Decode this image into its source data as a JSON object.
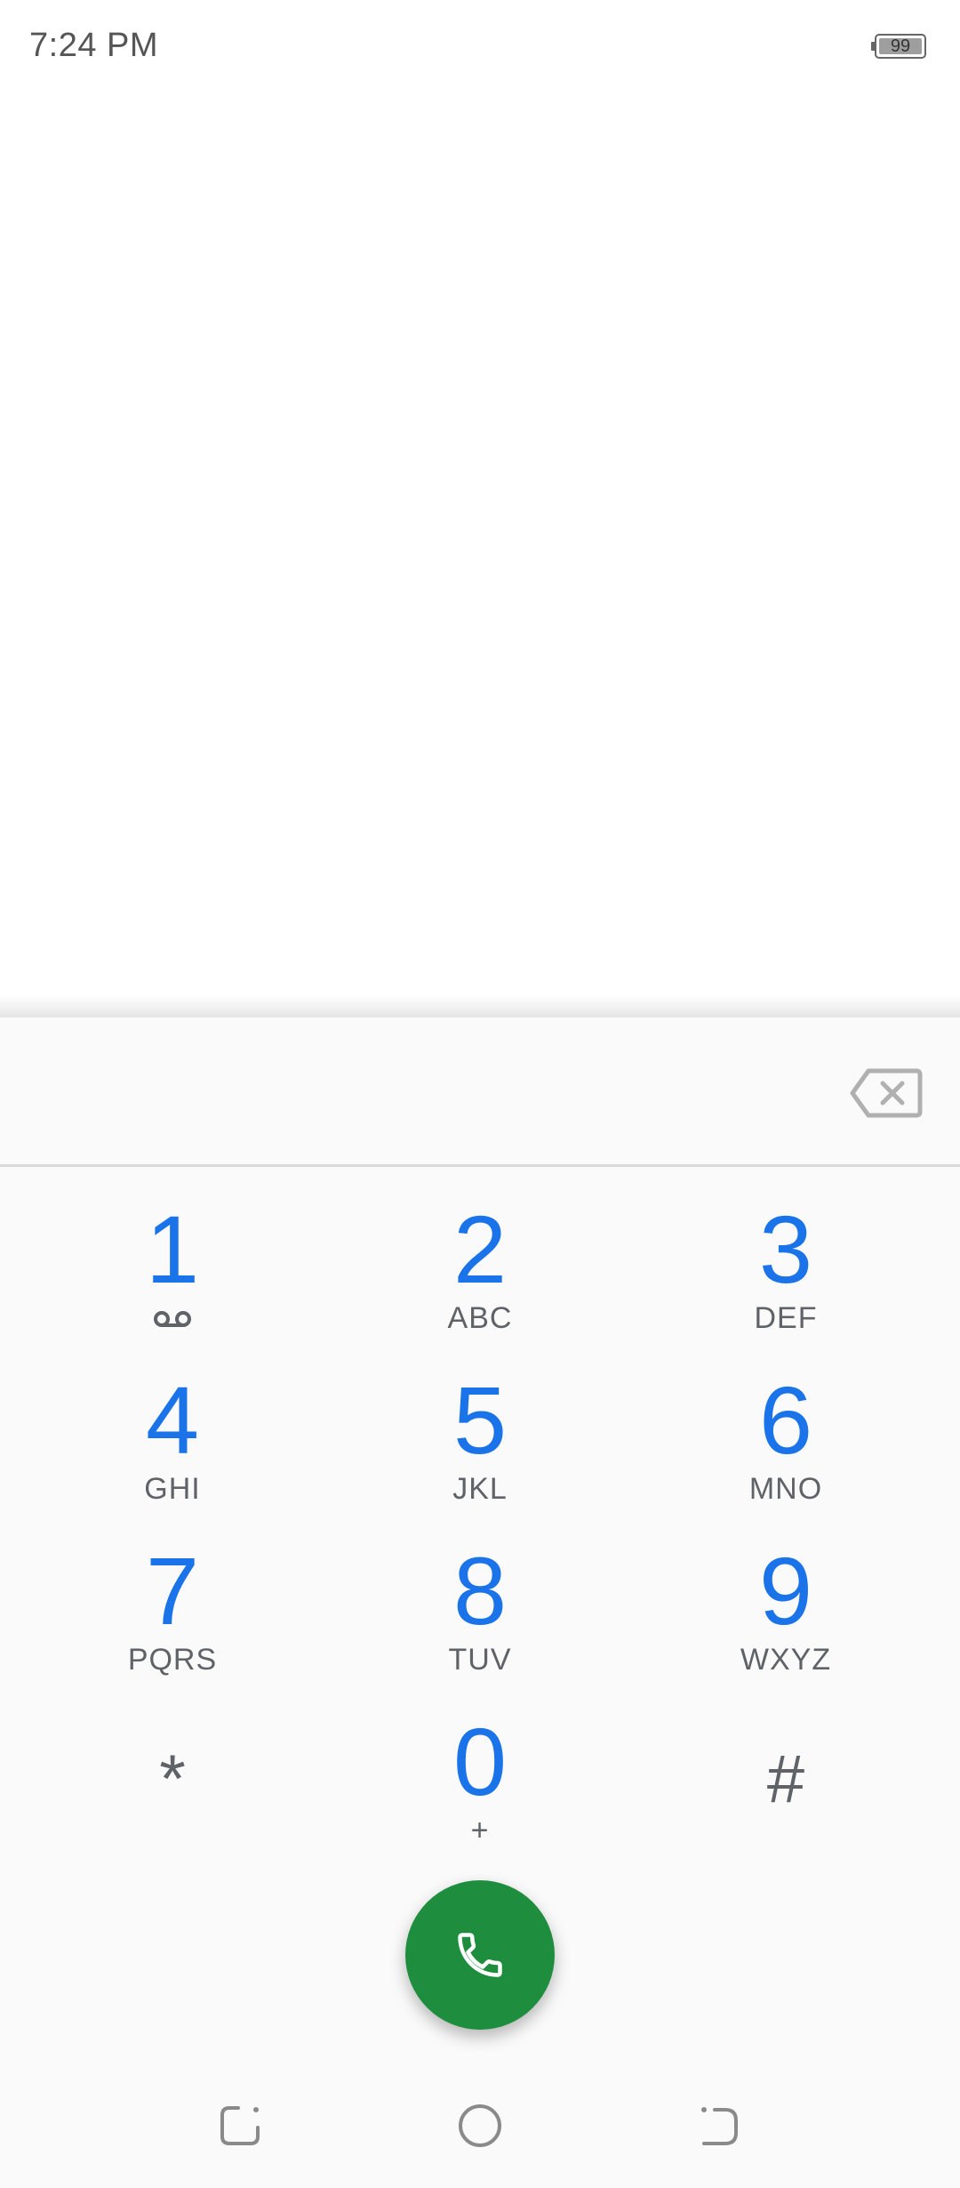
{
  "status_bar": {
    "time": "7:24 PM",
    "battery_level": "99"
  },
  "dialer": {
    "digits_value": "",
    "backspace_icon": "backspace-icon",
    "keys": [
      {
        "digit": "1",
        "letters": "",
        "icon": "voicemail-icon"
      },
      {
        "digit": "2",
        "letters": "ABC"
      },
      {
        "digit": "3",
        "letters": "DEF"
      },
      {
        "digit": "4",
        "letters": "GHI"
      },
      {
        "digit": "5",
        "letters": "JKL"
      },
      {
        "digit": "6",
        "letters": "MNO"
      },
      {
        "digit": "7",
        "letters": "PQRS"
      },
      {
        "digit": "8",
        "letters": "TUV"
      },
      {
        "digit": "9",
        "letters": "WXYZ"
      },
      {
        "digit": "*",
        "letters": ""
      },
      {
        "digit": "0",
        "letters": "+"
      },
      {
        "digit": "#",
        "letters": ""
      }
    ],
    "call_icon": "phone-icon"
  },
  "nav_bar": {
    "recents_icon": "recents-icon",
    "home_icon": "home-icon",
    "back_icon": "back-icon"
  },
  "colors": {
    "digit_blue": "#1a73e8",
    "call_green": "#1e8e3e",
    "letters_gray": "#5f6368"
  }
}
